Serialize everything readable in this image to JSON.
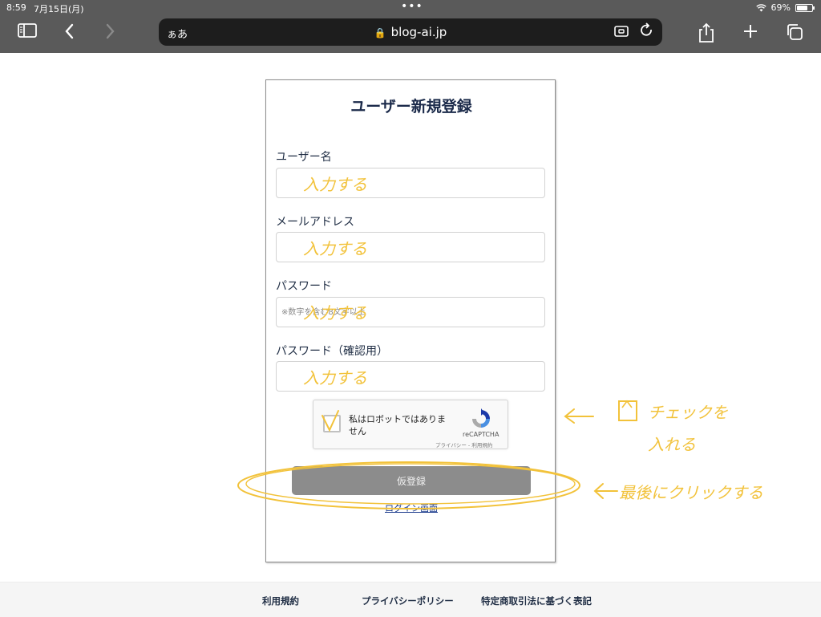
{
  "status_bar": {
    "time": "8:59",
    "date": "7月15日(月)",
    "battery": "69%",
    "wifi_icon": "wifi-icon",
    "battery_icon": "battery-icon"
  },
  "browser": {
    "text_size": "ぁあ",
    "url": "blog-ai.jp",
    "icons": [
      "sidebar-icon",
      "back-icon",
      "forward-icon",
      "lock-icon",
      "extension-icon",
      "reload-icon",
      "share-icon",
      "new-tab-icon",
      "tabs-icon"
    ]
  },
  "form": {
    "title": "ユーザー新規登録",
    "fields": [
      {
        "label": "ユーザー名",
        "placeholder": ""
      },
      {
        "label": "メールアドレス",
        "placeholder": ""
      },
      {
        "label": "パスワード",
        "placeholder": "※数字を含む8文字以上"
      },
      {
        "label": "パスワード（確認用）",
        "placeholder": ""
      }
    ],
    "recaptcha": {
      "label": "私はロボットではありません",
      "brand": "reCAPTCHA",
      "links": "プライバシー - 利用規約"
    },
    "submit_label": "仮登録",
    "login_link": "ログイン画面"
  },
  "footer": {
    "links": [
      "利用規約",
      "プライバシーポリシー",
      "特定商取引法に基づく表記"
    ]
  },
  "annotations": {
    "input_hint": "入力する",
    "check_hint_line1": "チェックを",
    "check_hint_line2": "入れる",
    "click_hint": "最後にクリックする",
    "color": "#f2c23a"
  }
}
